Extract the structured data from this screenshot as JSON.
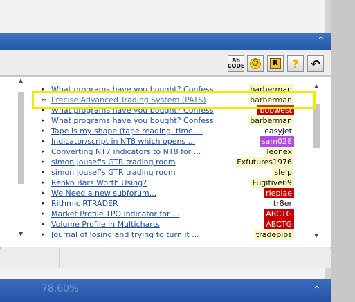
{
  "toolbar": {
    "buttons": [
      {
        "name": "bbcode-button",
        "label": "Bb\nCODE",
        "icon": "bbcode-icon"
      },
      {
        "name": "smiley-button",
        "label": "☺",
        "icon": "smiley-icon"
      },
      {
        "name": "r-button",
        "label": "R",
        "icon": "r-icon"
      },
      {
        "name": "help-button",
        "label": "?",
        "icon": "question-icon"
      },
      {
        "name": "back-button",
        "label": "↶",
        "icon": "undo-arrow-icon"
      }
    ]
  },
  "threads": [
    {
      "title": "What programs have you bought? Confess",
      "user": "barberman",
      "style": "default",
      "marker": "▸"
    },
    {
      "title": "Precise Advanced Trading System (PATS)",
      "user": "barberman",
      "style": "default",
      "marker": "▸▸"
    },
    {
      "title": "What programs have you bought? Confess",
      "user": "bobwest",
      "style": "red",
      "marker": "▸"
    },
    {
      "title": "What programs have you bought? Confess",
      "user": "barberman",
      "style": "default",
      "marker": "▸"
    },
    {
      "title": "Tape is my shape (tape reading, time ...",
      "user": "easyjet",
      "style": "plain",
      "marker": "▸"
    },
    {
      "title": "Indicator/script in NT8 which opens ...",
      "user": "sam028",
      "style": "purple",
      "marker": "▸"
    },
    {
      "title": "Converting NT7 indicators to NT8 for ...",
      "user": "leonex",
      "style": "default",
      "marker": "▸"
    },
    {
      "title": "simon jousef's GTR trading room",
      "user": "Fxfutures1976",
      "style": "default",
      "marker": "▸"
    },
    {
      "title": "simon jousef's GTR trading room",
      "user": "sleip",
      "style": "default",
      "marker": "▸"
    },
    {
      "title": "Renko Bars Worth Using?",
      "user": "Fugitive69",
      "style": "default",
      "marker": "▸"
    },
    {
      "title": "We Need a new subforum...",
      "user": "rleplae",
      "style": "red",
      "marker": "▸"
    },
    {
      "title": "Rithmic RTRADER",
      "user": "tr8er",
      "style": "plain",
      "marker": "▸"
    },
    {
      "title": "Market Profile TPO indicator for ...",
      "user": "ABCTG",
      "style": "red",
      "marker": "▸"
    },
    {
      "title": "Volume Profile in Multicharts",
      "user": "ABCTG",
      "style": "red",
      "marker": "▸"
    },
    {
      "title": "Journal of losing and trying to turn it ...",
      "user": "tradepips",
      "style": "default",
      "marker": "▸"
    }
  ],
  "ticker": {
    "text": "78.60%"
  },
  "colors": {
    "accent": "#2f63b5",
    "highlight": "#f0ea00",
    "link": "#1f4e9e",
    "red_badge": "#c40000",
    "purple_badge": "#b24be8"
  }
}
